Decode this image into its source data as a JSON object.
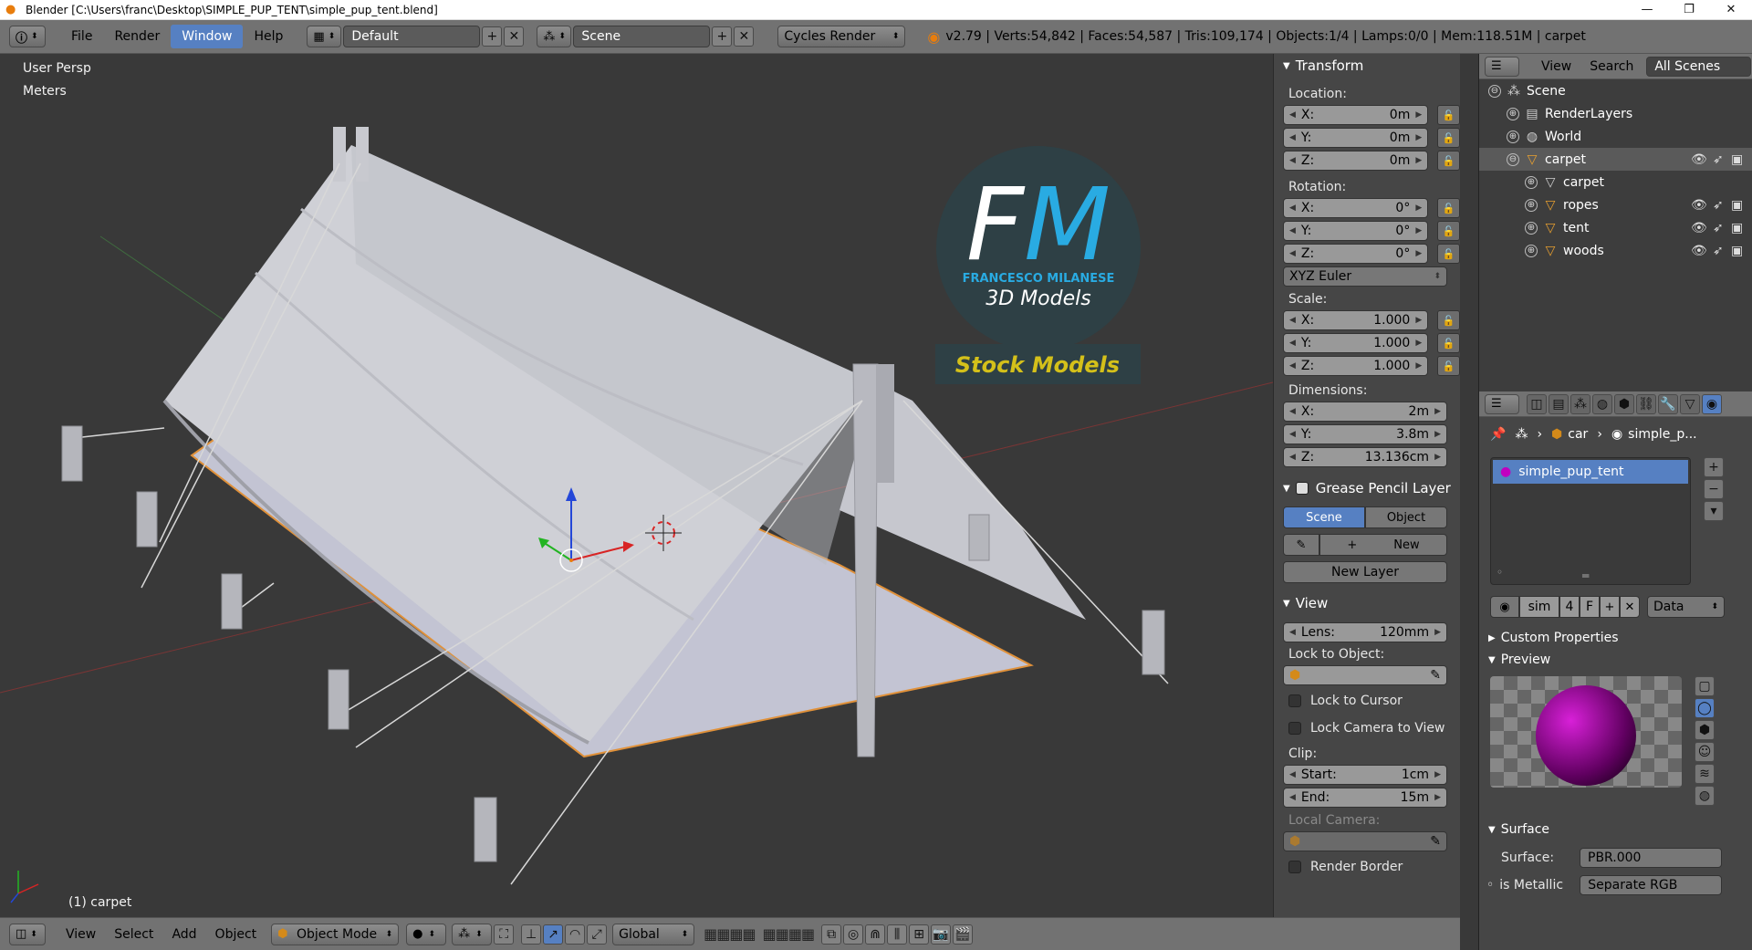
{
  "titlebar": {
    "title": "Blender [C:\\Users\\franc\\Desktop\\SIMPLE_PUP_TENT\\simple_pup_tent.blend]",
    "minimize": "—",
    "maximize": "❐",
    "close": "✕"
  },
  "infobar": {
    "menus": [
      "File",
      "Render",
      "Window",
      "Help"
    ],
    "active_menu": "Window",
    "layout": "Default",
    "scene": "Scene",
    "engine": "Cycles Render",
    "stats": "v2.79 | Verts:54,842 | Faces:54,587 | Tris:109,174 | Objects:1/4 | Lamps:0/0 | Mem:118.51M | carpet"
  },
  "viewport": {
    "view_label": "User Persp",
    "units_label": "Meters",
    "object_label": "(1) carpet",
    "logo_big": "FM",
    "logo_name": "FRANCESCO MILANESE",
    "logo_sub": "3D Models",
    "logo_banner": "Stock Models",
    "colors": {
      "bg": "#393939",
      "cyan": "#29abe2",
      "gold": "#d4c01a"
    }
  },
  "npanel": {
    "transform_title": "Transform",
    "location_label": "Location:",
    "location": [
      {
        "axis": "X:",
        "value": "0m"
      },
      {
        "axis": "Y:",
        "value": "0m"
      },
      {
        "axis": "Z:",
        "value": "0m"
      }
    ],
    "rotation_label": "Rotation:",
    "rotation": [
      {
        "axis": "X:",
        "value": "0°"
      },
      {
        "axis": "Y:",
        "value": "0°"
      },
      {
        "axis": "Z:",
        "value": "0°"
      }
    ],
    "rotation_mode": "XYZ Euler",
    "scale_label": "Scale:",
    "scale": [
      {
        "axis": "X:",
        "value": "1.000"
      },
      {
        "axis": "Y:",
        "value": "1.000"
      },
      {
        "axis": "Z:",
        "value": "1.000"
      }
    ],
    "dimensions_label": "Dimensions:",
    "dimensions": [
      {
        "axis": "X:",
        "value": "2m"
      },
      {
        "axis": "Y:",
        "value": "3.8m"
      },
      {
        "axis": "Z:",
        "value": "13.136cm"
      }
    ],
    "grease_title": "Grease Pencil Layer",
    "gp_scene": "Scene",
    "gp_object": "Object",
    "gp_new": "New",
    "gp_new_layer": "New Layer",
    "view_title": "View",
    "lens_label": "Lens:",
    "lens_value": "120mm",
    "lock_to_object": "Lock to Object:",
    "lock_to_cursor": "Lock to Cursor",
    "lock_camera": "Lock Camera to View",
    "clip_label": "Clip:",
    "clip_start_label": "Start:",
    "clip_start": "1cm",
    "clip_end_label": "End:",
    "clip_end": "15m",
    "local_camera": "Local Camera:",
    "render_border": "Render Border"
  },
  "outliner": {
    "view": "View",
    "search": "Search",
    "filter": "All Scenes",
    "items": [
      {
        "label": "Scene",
        "icon": "scene-icon",
        "indent": 0
      },
      {
        "label": "RenderLayers",
        "icon": "renderlayers-icon",
        "indent": 1
      },
      {
        "label": "World",
        "icon": "world-icon",
        "indent": 1
      },
      {
        "label": "carpet",
        "icon": "mesh-object-icon",
        "indent": 1
      },
      {
        "label": "carpet",
        "icon": "mesh-data-icon",
        "indent": 2
      },
      {
        "label": "ropes",
        "icon": "mesh-object-icon",
        "indent": 2
      },
      {
        "label": "tent",
        "icon": "mesh-object-icon",
        "indent": 2
      },
      {
        "label": "woods",
        "icon": "mesh-object-icon",
        "indent": 2
      }
    ]
  },
  "properties": {
    "breadcrumb_obj": "car",
    "breadcrumb_mat": "simple_p...",
    "material_slot": "simple_pup_tent",
    "mat_name": "sim",
    "mat_users": "4",
    "mat_fake": "F",
    "mat_link": "Data",
    "custom_props": "Custom Properties",
    "preview": "Preview",
    "surface_title": "Surface",
    "surface_label": "Surface:",
    "surface_value": "PBR.000",
    "metallic_label": "is Metallic",
    "metallic_value": "Separate RGB"
  },
  "bottombar": {
    "menus": [
      "View",
      "Select",
      "Add",
      "Object"
    ],
    "mode": "Object Mode",
    "orientation": "Global"
  }
}
